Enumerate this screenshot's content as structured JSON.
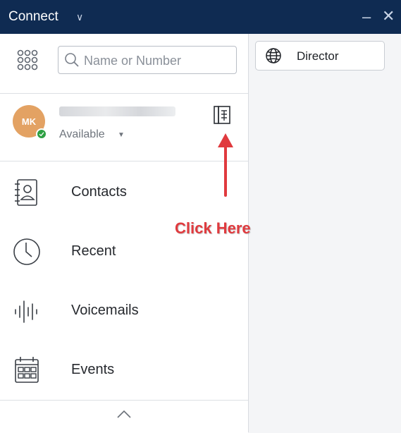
{
  "app": {
    "title": "Connect",
    "accent": "#0f2b52"
  },
  "search": {
    "placeholder": "Name or Number"
  },
  "user": {
    "initials": "MK",
    "status": "Available",
    "status_color": "#2ea043",
    "avatar_color": "#e3a263"
  },
  "nav": {
    "items": [
      {
        "label": "Contacts",
        "icon": "contacts-book-icon"
      },
      {
        "label": "Recent",
        "icon": "clock-icon"
      },
      {
        "label": "Voicemails",
        "icon": "voicemail-waveform-icon"
      },
      {
        "label": "Events",
        "icon": "calendar-icon"
      }
    ]
  },
  "right_panel": {
    "director_label": "Director"
  },
  "annotation": {
    "text": "Click Here",
    "color": "#e03a3e"
  }
}
